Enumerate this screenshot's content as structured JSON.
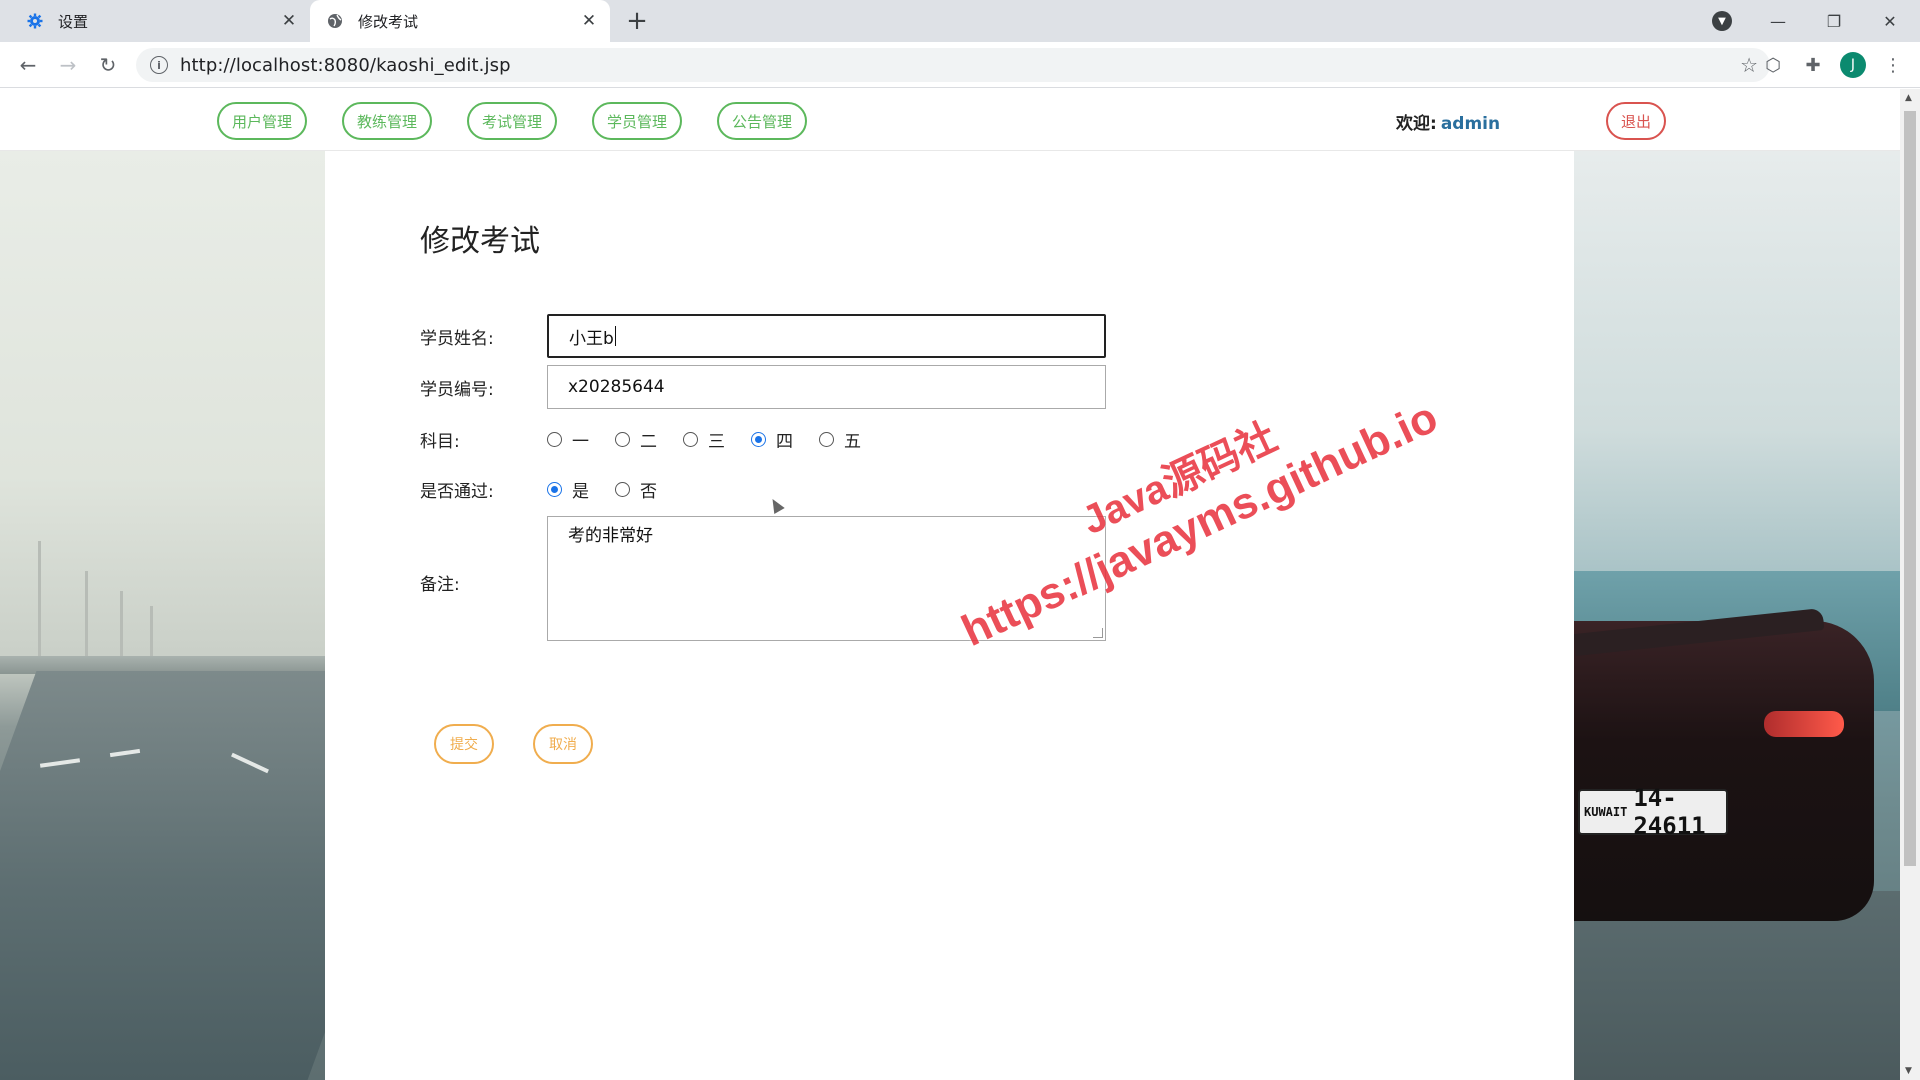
{
  "browser": {
    "tabs": [
      {
        "title": "设置",
        "icon": "gear-icon",
        "active": false
      },
      {
        "title": "修改考试",
        "icon": "globe-icon",
        "active": true
      }
    ],
    "url": "http://localhost:8080/kaoshi_edit.jsp",
    "profile_initial": "J"
  },
  "nav": {
    "items": [
      "用户管理",
      "教练管理",
      "考试管理",
      "学员管理",
      "公告管理"
    ],
    "welcome_label": "欢迎:",
    "username": "admin",
    "logout_label": "退出",
    "button_color": "#5cb85c",
    "logout_color": "#d9534f"
  },
  "sides": {
    "right_plate_country": "KUWAIT",
    "right_plate_number": "14-24611"
  },
  "form": {
    "title": "修改考试",
    "name_label": "学员姓名:",
    "name_value": "小王b",
    "number_label": "学员编号:",
    "number_value": "x20285644",
    "subject_label": "科目:",
    "subject_options": [
      "一",
      "二",
      "三",
      "四",
      "五"
    ],
    "subject_selected": "四",
    "pass_label": "是否通过:",
    "pass_options": [
      "是",
      "否"
    ],
    "pass_selected": "是",
    "remark_label": "备注:",
    "remark_value": "考的非常好",
    "submit_label": "提交",
    "cancel_label": "取消",
    "action_color": "#f0ad4e"
  },
  "watermark": {
    "line1": "Java源码社",
    "line2": "https://javayms.github.io"
  }
}
